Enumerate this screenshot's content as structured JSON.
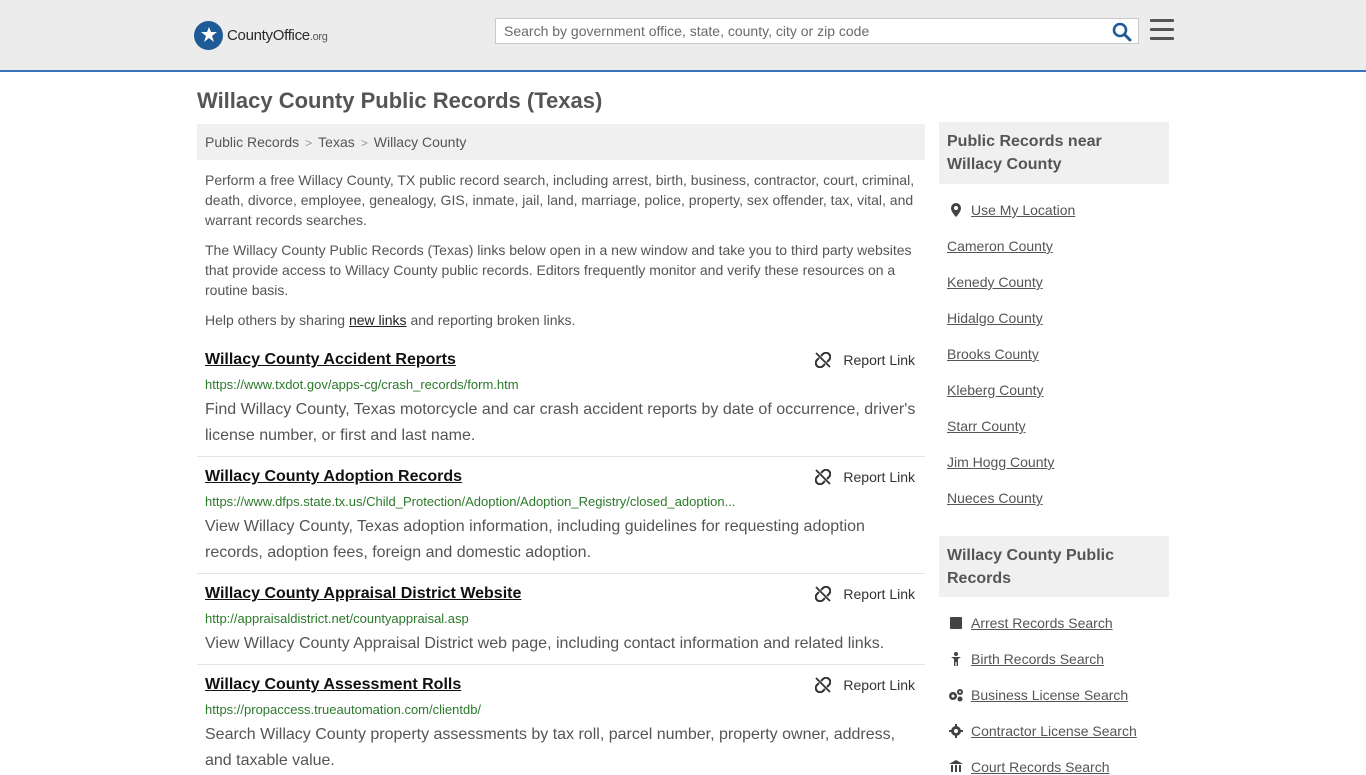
{
  "header": {
    "logo_main": "CountyOffice",
    "logo_tld": ".org",
    "search_placeholder": "Search by government office, state, county, city or zip code"
  },
  "page_title": "Willacy County Public Records (Texas)",
  "breadcrumb": [
    "Public Records",
    "Texas",
    "Willacy County"
  ],
  "breadcrumb_sep": ">",
  "intro": {
    "p1": "Perform a free Willacy County, TX public record search, including arrest, birth, business, contractor, court, criminal, death, divorce, employee, genealogy, GIS, inmate, jail, land, marriage, police, property, sex offender, tax, vital, and warrant records searches.",
    "p2": "The Willacy County Public Records (Texas) links below open in a new window and take you to third party websites that provide access to Willacy County public records. Editors frequently monitor and verify these resources on a routine basis.",
    "p3_before": "Help others by sharing ",
    "p3_link": "new links",
    "p3_after": " and reporting broken links."
  },
  "report_label": "Report Link",
  "results": [
    {
      "title": "Willacy County Accident Reports",
      "url": "https://www.txdot.gov/apps-cg/crash_records/form.htm",
      "desc": "Find Willacy County, Texas motorcycle and car crash accident reports by date of occurrence, driver's license number, or first and last name."
    },
    {
      "title": "Willacy County Adoption Records",
      "url": "https://www.dfps.state.tx.us/Child_Protection/Adoption/Adoption_Registry/closed_adoption...",
      "desc": "View Willacy County, Texas adoption information, including guidelines for requesting adoption records, adoption fees, foreign and domestic adoption."
    },
    {
      "title": "Willacy County Appraisal District Website",
      "url": "http://appraisaldistrict.net/countyappraisal.asp",
      "desc": "View Willacy County Appraisal District web page, including contact information and related links."
    },
    {
      "title": "Willacy County Assessment Rolls",
      "url": "https://propaccess.trueautomation.com/clientdb/",
      "desc": "Search Willacy County property assessments by tax roll, parcel number, property owner, address, and taxable value."
    }
  ],
  "sidebar": {
    "near_heading": "Public Records near Willacy County",
    "use_location": "Use My Location",
    "near_counties": [
      "Cameron County",
      "Kenedy County",
      "Hidalgo County",
      "Brooks County",
      "Kleberg County",
      "Starr County",
      "Jim Hogg County",
      "Nueces County"
    ],
    "records_heading": "Willacy County Public Records",
    "record_links": [
      {
        "label": "Arrest Records Search",
        "icon": "square-icon"
      },
      {
        "label": "Birth Records Search",
        "icon": "child-icon"
      },
      {
        "label": "Business License Search",
        "icon": "gears-icon"
      },
      {
        "label": "Contractor License Search",
        "icon": "gear-icon"
      },
      {
        "label": "Court Records Search",
        "icon": "courthouse-icon"
      }
    ]
  },
  "colors": {
    "accent": "#3b73b9",
    "url_green": "#2b7a2b",
    "logo_blue": "#1e5a96"
  }
}
